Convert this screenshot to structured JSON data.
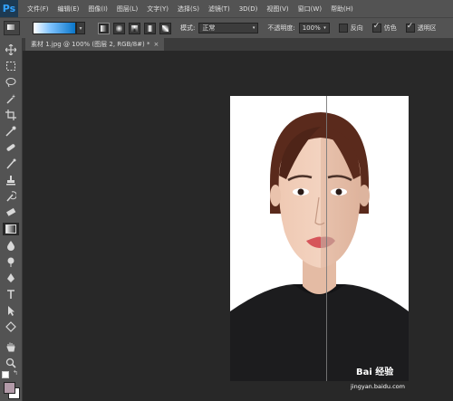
{
  "app": {
    "logo": "Ps"
  },
  "menu": [
    "文件(F)",
    "编辑(E)",
    "图像(I)",
    "图层(L)",
    "文字(Y)",
    "选择(S)",
    "滤镜(T)",
    "3D(D)",
    "视图(V)",
    "窗口(W)",
    "帮助(H)"
  ],
  "options": {
    "mode_label": "模式:",
    "mode_value": "正常",
    "opacity_label": "不透明度:",
    "opacity_value": "100%",
    "reverse_label": "反向",
    "reverse_checked": false,
    "dither_label": "仿色",
    "dither_checked": true,
    "transparency_label": "透明区",
    "transparency_checked": true,
    "gradient_colors": [
      "#ffffff",
      "#7fc3ff",
      "#0a76c9"
    ]
  },
  "document": {
    "tab_title": "素材 1.jpg @ 100% (图层 2, RGB/8#) *",
    "close_glyph": "×"
  },
  "tools": [
    "move-icon",
    "marquee-icon",
    "lasso-icon",
    "magic-wand-icon",
    "crop-icon",
    "eyedropper-icon",
    "healing-brush-icon",
    "brush-icon",
    "clone-stamp-icon",
    "history-brush-icon",
    "eraser-icon",
    "gradient-icon",
    "blur-icon",
    "dodge-icon",
    "pen-icon",
    "type-icon",
    "path-selection-icon",
    "shape-icon",
    "hand-icon",
    "zoom-icon"
  ],
  "colors": {
    "foreground": "#b29aa8",
    "background": "#ffffff",
    "accent": "#33a3ff"
  },
  "watermark": {
    "text": "Bai 经验",
    "url": "jingyan.baidu.com"
  }
}
